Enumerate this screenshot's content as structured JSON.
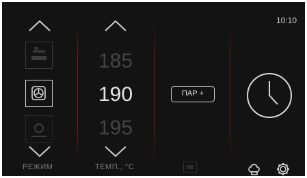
{
  "status": {
    "time": "10:10"
  },
  "mode": {
    "label": "РЕЖИМ",
    "options": [
      "top-heat",
      "convection-fan",
      "fan-with-bottom"
    ],
    "selected": "convection-fan"
  },
  "temperature": {
    "label": "ТЕМП., °C",
    "values": [
      "185",
      "190",
      "195"
    ],
    "selected": "190"
  },
  "steam": {
    "label": "ПАР +"
  },
  "colors": {
    "background": "#131313",
    "divider": "#7a1a1a",
    "active": "#e6e6e6",
    "dim": "#444444"
  }
}
